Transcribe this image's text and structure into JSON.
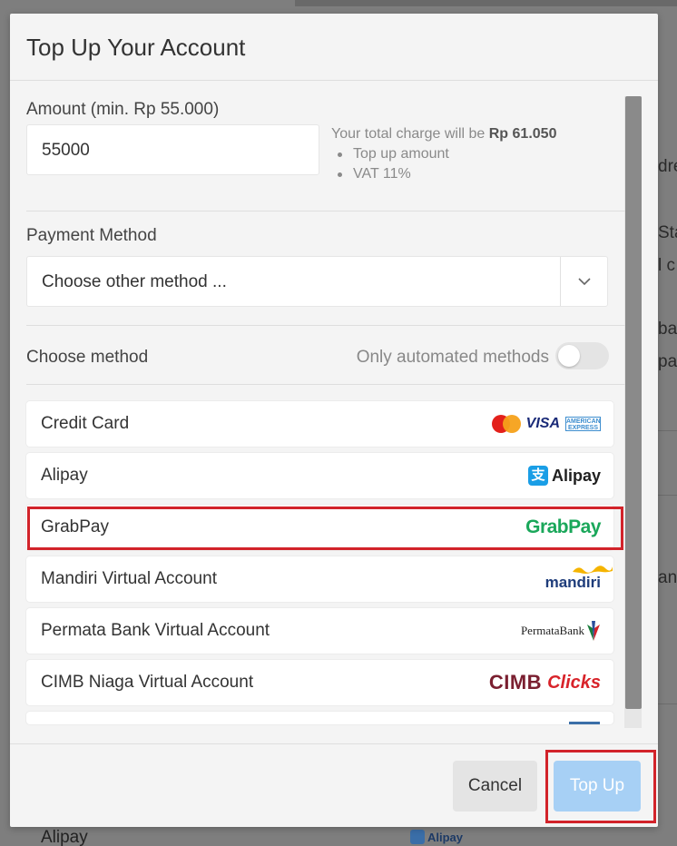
{
  "background": {
    "fragments": [
      "dre",
      "Sta",
      "l c",
      "ba",
      "paig",
      "an"
    ],
    "bottom_item_label": "Alipay",
    "bottom_item_logo": "Alipay"
  },
  "modal": {
    "title": "Top Up Your Account",
    "amount": {
      "label": "Amount (min. Rp 55.000)",
      "value": "55000",
      "charge_prefix": "Your total charge will be",
      "charge_total": "Rp 61.050",
      "breakdown": [
        "Top up amount",
        "VAT 11%"
      ]
    },
    "payment_method": {
      "label": "Payment Method",
      "selected": "Choose other method ..."
    },
    "choose_method": {
      "label": "Choose method",
      "toggle_label": "Only automated methods",
      "toggle_on": false
    },
    "methods": [
      {
        "label": "Credit Card",
        "logo": "mastercard-visa-amex-logos"
      },
      {
        "label": "Alipay",
        "logo": "alipay-logo"
      },
      {
        "label": "GrabPay",
        "logo": "grabpay-logo"
      },
      {
        "label": "Mandiri Virtual Account",
        "logo": "mandiri-logo"
      },
      {
        "label": "Permata Bank Virtual Account",
        "logo": "permata-bank-logo"
      },
      {
        "label": "CIMB Niaga Virtual Account",
        "logo": "cimb-clicks-logo"
      }
    ],
    "logos": {
      "mastercard": "MasterCard",
      "visa": "VISA",
      "amex_line1": "AMERICAN",
      "amex_line2": "EXPRESS",
      "alipay_mark": "支",
      "alipay": "Alipay",
      "grabpay": "GrabPay",
      "mandiri": "mandiri",
      "permata": "PermataBank",
      "cimb": "CIMB",
      "clicks": "Clicks"
    },
    "footer": {
      "cancel_label": "Cancel",
      "topup_label": "Top Up"
    }
  },
  "colors": {
    "highlight": "#d2232a",
    "topup_button": "#a7d0f5",
    "grabpay_green": "#1aa75a"
  }
}
